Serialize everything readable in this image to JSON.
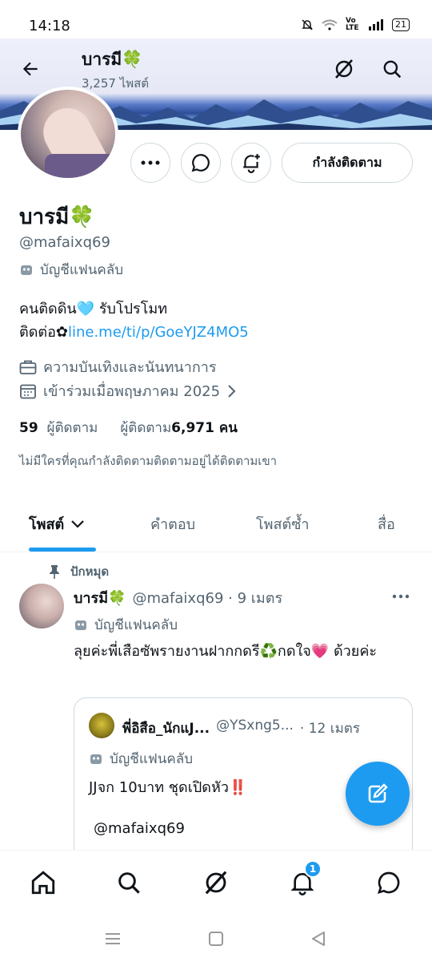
{
  "status_bar": {
    "time": "14:18",
    "network": "Vo LTE",
    "battery": "21"
  },
  "header": {
    "title": "บารมี🍀",
    "post_count": "3,257 ไพสต์"
  },
  "profile": {
    "name": "บารมี🍀",
    "handle": "@mafaixq69",
    "fan_label": "บัญชีแฟนคลับ",
    "bio_line1": "คนติดดิน🩵 รับโปรโมท",
    "bio_line2_prefix": "ติดต่อ✿",
    "bio_link": "line.me/ti/p/GoeYJZ4MO5",
    "category": "ความบันเทิงและนันทนาการ",
    "joined": "เข้าร่วมเมื่อพฤษภาคม 2025",
    "following_count": "59",
    "following_label": "ผู้ติดตาม",
    "followers_label": "ผู้ติดตาม",
    "followers_count": "6,971 คน",
    "mutual_text": "ไม่มีใครที่คุณกำลังติดตามติดตามอยู่ได้ติดตามเขา"
  },
  "actions": {
    "following_button": "กำลังติดตาม"
  },
  "tabs": [
    {
      "label": "โพสต์"
    },
    {
      "label": "คำตอบ"
    },
    {
      "label": "โพสต์ซ้ำ"
    },
    {
      "label": "สื่อ"
    }
  ],
  "post": {
    "pinned_label": "ปักหมุด",
    "name": "บารมี🍀",
    "handle_time": "@mafaixq69 · 9 เมตร",
    "fan_label": "บัญชีแฟนคลับ",
    "text": "ลุยค่ะพี่เสือซัพรายงานฝากกดรี♻️กดใจ💗 ด้วยค่ะ",
    "quote": {
      "name": "พี่อิสือ_นักแJ...",
      "handle": "@YSxng5...",
      "time": "· 12 เมตร",
      "fan_label": "บัญชีแฟนคลับ",
      "text1": "JJจก 10บาท ชุดเปิดหัว‼️",
      "text2": "@mafaixq69"
    }
  },
  "bottom_nav": {
    "notifications_badge": "1"
  },
  "icons": [
    "back-arrow-icon",
    "grok-icon",
    "search-icon",
    "more-icon",
    "message-icon",
    "bell-plus-icon",
    "fan-mask-icon",
    "briefcase-icon",
    "calendar-icon",
    "chevron-right-icon",
    "chevron-down-icon",
    "pin-icon",
    "compose-icon",
    "home-icon",
    "bell-icon"
  ],
  "colors": {
    "accent": "#1d9bf0",
    "secondary_text": "#536471",
    "border": "#cfd9de"
  }
}
